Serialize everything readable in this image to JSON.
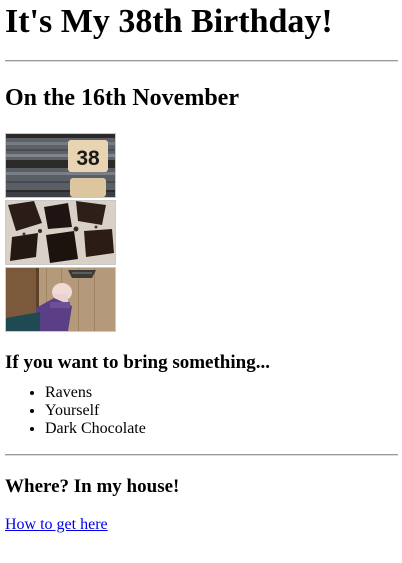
{
  "page": {
    "title": "It's My 38th Birthday!",
    "date_heading": "On the 16th November",
    "bring_heading": "If you want to bring something...",
    "bring_items": [
      "Ravens",
      "Yourself",
      "Dark Chocolate"
    ],
    "where_heading": "Where? In my house!",
    "directions_link": "How to get here"
  },
  "photos": [
    {
      "name": "number-38-photo",
      "subject": "yarn spool with number label",
      "label_text": "38"
    },
    {
      "name": "dark-chocolate-photo",
      "subject": "broken dark chocolate pieces"
    },
    {
      "name": "door-knock-photo",
      "subject": "hand knocking on a wooden door"
    }
  ],
  "colors": {
    "link": "#0000ee",
    "text": "#000000",
    "rule": "#9a9a9a"
  }
}
